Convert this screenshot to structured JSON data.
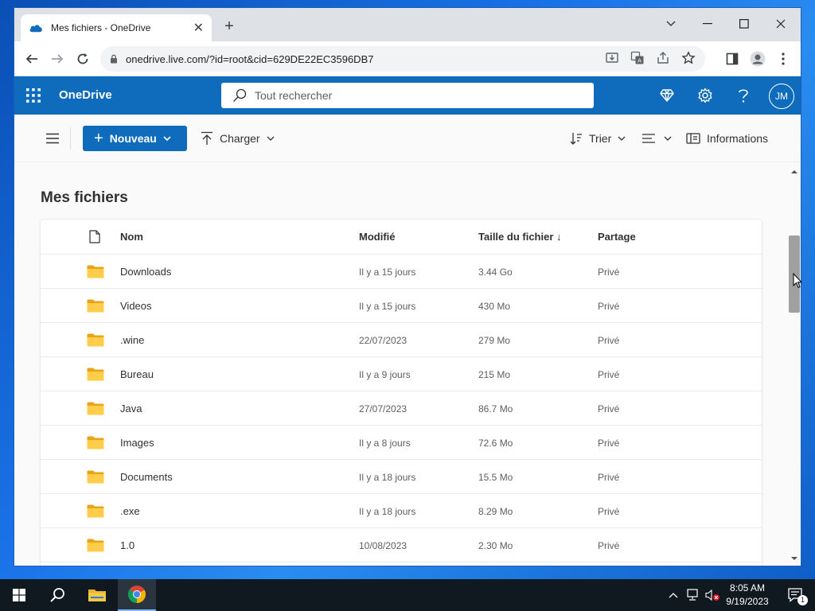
{
  "browser": {
    "tab_title": "Mes fichiers - OneDrive",
    "new_tab": "+",
    "url": "onedrive.live.com/?id=root&cid=629DE22EC3596DB7"
  },
  "app": {
    "name": "OneDrive",
    "search_placeholder": "Tout rechercher",
    "avatar_initials": "JM",
    "accent": "#0f6cbd"
  },
  "commands": {
    "new_label": "Nouveau",
    "upload_label": "Charger",
    "sort_label": "Trier",
    "info_label": "Informations"
  },
  "page": {
    "title": "Mes fichiers"
  },
  "files": {
    "headers": {
      "name": "Nom",
      "modified": "Modifié",
      "size": "Taille du fichier ↓",
      "sharing": "Partage"
    },
    "rows": [
      {
        "name": "Downloads",
        "modified": "Il y a 15 jours",
        "size": "3.44 Go",
        "sharing": "Privé"
      },
      {
        "name": "Videos",
        "modified": "Il y a 15 jours",
        "size": "430 Mo",
        "sharing": "Privé"
      },
      {
        "name": ".wine",
        "modified": "22/07/2023",
        "size": "279 Mo",
        "sharing": "Privé"
      },
      {
        "name": "Bureau",
        "modified": "Il y a 9 jours",
        "size": "215 Mo",
        "sharing": "Privé"
      },
      {
        "name": "Java",
        "modified": "27/07/2023",
        "size": "86.7 Mo",
        "sharing": "Privé"
      },
      {
        "name": "Images",
        "modified": "Il y a 8 jours",
        "size": "72.6 Mo",
        "sharing": "Privé"
      },
      {
        "name": "Documents",
        "modified": "Il y a 18 jours",
        "size": "15.5 Mo",
        "sharing": "Privé"
      },
      {
        "name": ".exe",
        "modified": "Il y a 18 jours",
        "size": "8.29 Mo",
        "sharing": "Privé"
      },
      {
        "name": "1.0",
        "modified": "10/08/2023",
        "size": "2.30 Mo",
        "sharing": "Privé"
      }
    ]
  },
  "taskbar": {
    "time": "8:05 AM",
    "date": "9/19/2023",
    "notification_count": "1"
  }
}
